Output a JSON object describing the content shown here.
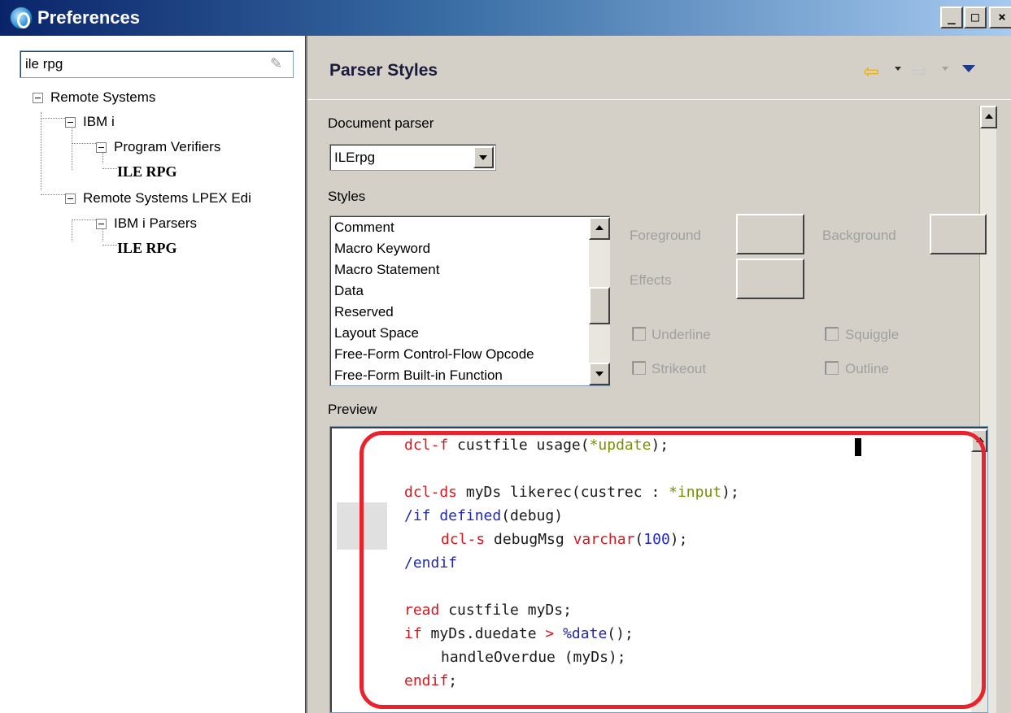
{
  "window": {
    "title": "Preferences",
    "buttons": {
      "minimize": "_",
      "maximize": "□",
      "close": "×"
    }
  },
  "filter": {
    "value": "ile rpg"
  },
  "tree": {
    "remote_systems": "Remote Systems",
    "ibm_i": "IBM i",
    "program_verifiers": "Program Verifiers",
    "ile_rpg_1": "ILE RPG",
    "lpex": "Remote Systems LPEX Edi",
    "ibm_i_parsers": "IBM i Parsers",
    "ile_rpg_2": "ILE RPG"
  },
  "page": {
    "title": "Parser Styles"
  },
  "document_parser": {
    "label": "Document parser",
    "value": "ILErpg"
  },
  "styles": {
    "label": "Styles",
    "items": [
      "Comment",
      "Macro Keyword",
      "Macro Statement",
      "Data",
      "Reserved",
      "Layout Space",
      "Free-Form Control-Flow Opcode",
      "Free-Form Built-in Function"
    ]
  },
  "attributes": {
    "foreground": "Foreground",
    "background": "Background",
    "effects": "Effects",
    "underline": "Underline",
    "squiggle": "Squiggle",
    "strikeout": "Strikeout",
    "outline": "Outline"
  },
  "preview": {
    "label": "Preview",
    "lines": {
      "l1_kw": "dcl-f",
      "l1_rest": " custfile usage(",
      "l1_str": "*update",
      "l1_end": ");",
      "l3_kw": "dcl-ds",
      "l3_rest": " myDs likerec(custrec : ",
      "l3_str": "*input",
      "l3_end": ");",
      "l4_a": "/if defined",
      "l4_b": "(debug)",
      "l5_kw": "dcl-s",
      "l5_rest": " debugMsg ",
      "l5_kw2": "varchar",
      "l5_p1": "(",
      "l5_num": "100",
      "l5_p2": ");",
      "l6": "/endif",
      "l8_kw": "read",
      "l8_rest": " custfile myDs;",
      "l9_kw": "if",
      "l9_rest": " myDs.duedate ",
      "l9_op": ">",
      "l9_sp": " ",
      "l9_bif": "%date",
      "l9_end": "();",
      "l10": "handleOverdue (myDs);",
      "l11_kw": "endif",
      "l11_end": ";"
    }
  },
  "colors": {
    "keyword": "#d8171e",
    "directive": "#2028b0",
    "special_value": "#7a8f00",
    "highlight_box": "#e8232e"
  },
  "icons": [
    "app-icon",
    "back-arrow-icon",
    "forward-arrow-icon",
    "view-menu-icon",
    "clear-filter-icon"
  ]
}
